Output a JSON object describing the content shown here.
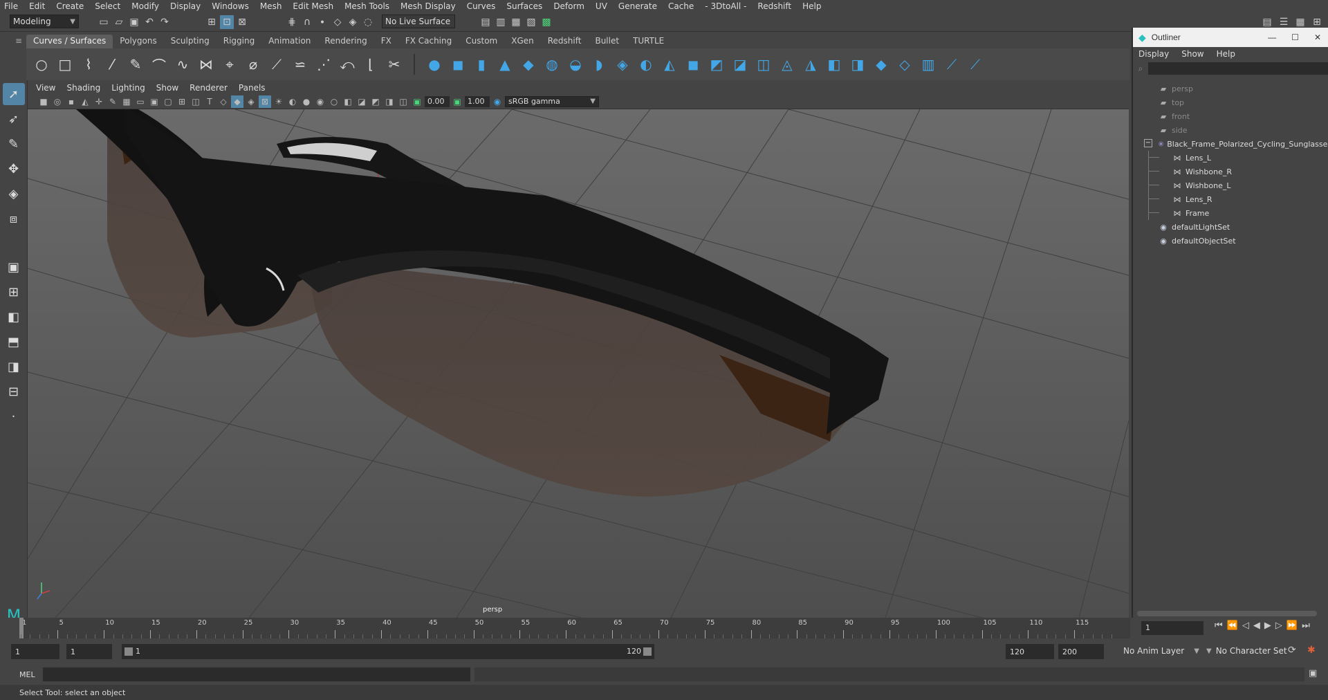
{
  "menubar": [
    "File",
    "Edit",
    "Create",
    "Select",
    "Modify",
    "Display",
    "Windows",
    "Mesh",
    "Edit Mesh",
    "Mesh Tools",
    "Mesh Display",
    "Curves",
    "Surfaces",
    "Deform",
    "UV",
    "Generate",
    "Cache",
    "- 3DtoAll -",
    "Redshift",
    "Help"
  ],
  "status": {
    "mode": "Modeling",
    "live_surface": "No Live Surface"
  },
  "shelf_tabs": [
    "Curves / Surfaces",
    "Polygons",
    "Sculpting",
    "Rigging",
    "Animation",
    "Rendering",
    "FX",
    "FX Caching",
    "Custom",
    "XGen",
    "Redshift",
    "Bullet",
    "TURTLE"
  ],
  "shelf_active": "Curves / Surfaces",
  "panel_menu": [
    "View",
    "Shading",
    "Lighting",
    "Show",
    "Renderer",
    "Panels"
  ],
  "panel_toolbar": {
    "exposure": "0.00",
    "gamma": "1.00",
    "color_space": "sRGB gamma"
  },
  "viewport": {
    "camera_label": "persp"
  },
  "outliner": {
    "title": "Outliner",
    "menu": [
      "Display",
      "Show",
      "Help"
    ],
    "items": [
      {
        "label": "persp",
        "icon": "camera-icon",
        "indent": 0,
        "dim": true
      },
      {
        "label": "top",
        "icon": "camera-icon",
        "indent": 0,
        "dim": true
      },
      {
        "label": "front",
        "icon": "camera-icon",
        "indent": 0,
        "dim": true
      },
      {
        "label": "side",
        "icon": "camera-icon",
        "indent": 0,
        "dim": true
      },
      {
        "label": "Black_Frame_Polarized_Cycling_Sunglasses_",
        "icon": "group-icon",
        "indent": 0,
        "dim": false,
        "expanded": true
      },
      {
        "label": "Lens_L",
        "icon": "mesh-icon",
        "indent": 1,
        "dim": false
      },
      {
        "label": "Wishbone_R",
        "icon": "mesh-icon",
        "indent": 1,
        "dim": false
      },
      {
        "label": "Wishbone_L",
        "icon": "mesh-icon",
        "indent": 1,
        "dim": false
      },
      {
        "label": "Lens_R",
        "icon": "mesh-icon",
        "indent": 1,
        "dim": false
      },
      {
        "label": "Frame",
        "icon": "mesh-icon",
        "indent": 1,
        "dim": false
      },
      {
        "label": "defaultLightSet",
        "icon": "set-icon",
        "indent": 0,
        "dim": false
      },
      {
        "label": "defaultObjectSet",
        "icon": "set-icon",
        "indent": 0,
        "dim": false
      }
    ]
  },
  "timeline": {
    "ticks": [
      1,
      5,
      10,
      15,
      20,
      25,
      30,
      35,
      40,
      45,
      50,
      55,
      60,
      65,
      70,
      75,
      80,
      85,
      90,
      95,
      100,
      105,
      110,
      115
    ],
    "current_frame": "1"
  },
  "range": {
    "start": "1",
    "playback_start": "1",
    "slider_start": "1",
    "slider_end": "120",
    "playback_end": "120",
    "end": "200",
    "anim_layer": "No Anim Layer",
    "char_set": "No Character Set"
  },
  "cmdline": {
    "label": "MEL"
  },
  "help_line": "Select Tool: select an object"
}
